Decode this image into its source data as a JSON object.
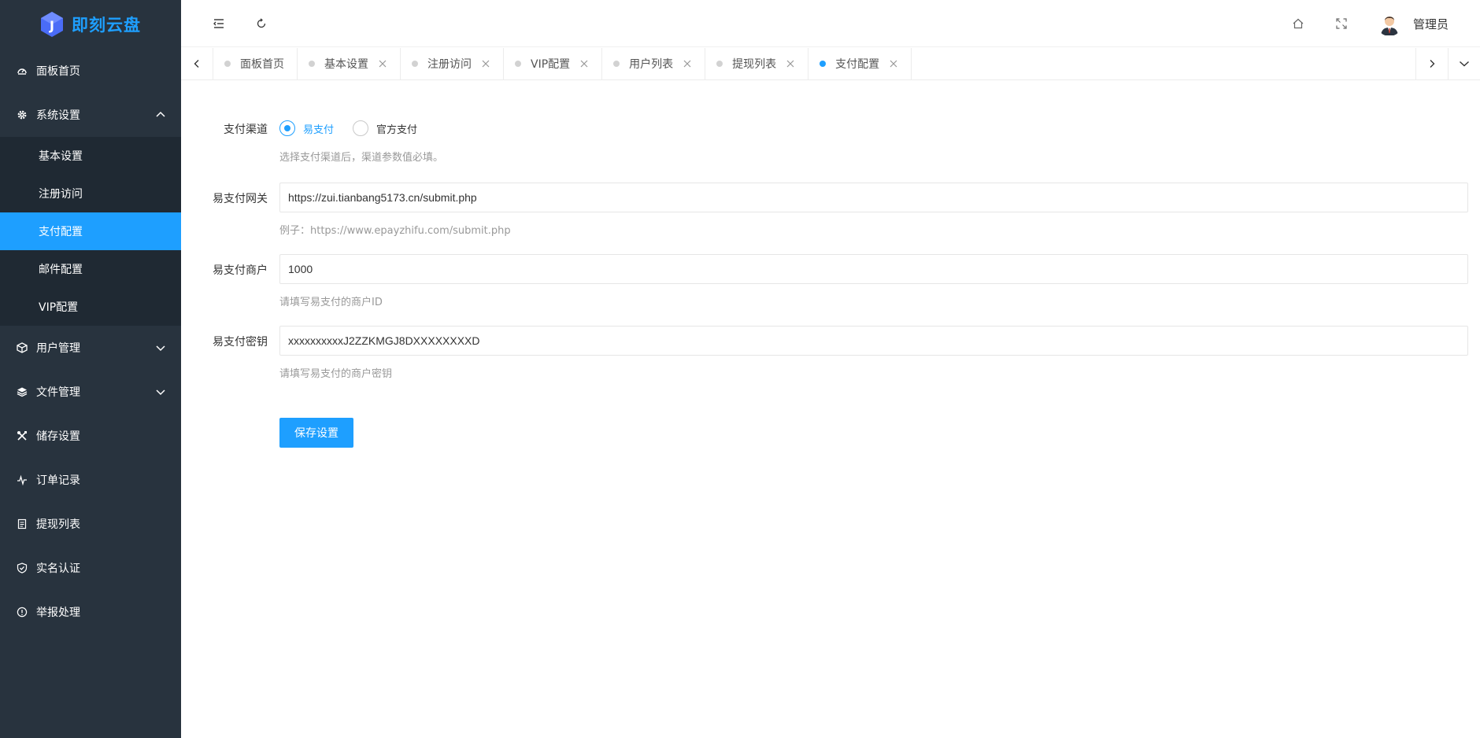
{
  "app": {
    "logo_text": "即刻云盘",
    "accent": "#1e9fff",
    "sidebar_bg": "#28333e",
    "submenu_bg": "#1f2933"
  },
  "sidebar": {
    "items": [
      {
        "label": "面板首页",
        "icon": "dashboard-icon"
      },
      {
        "label": "系统设置",
        "icon": "gear-icon",
        "expanded": true,
        "children": [
          "基本设置",
          "注册访问",
          "支付配置",
          "邮件配置",
          "VIP配置"
        ],
        "active_child": "支付配置"
      },
      {
        "label": "用户管理",
        "icon": "cube-icon",
        "collapsible": true
      },
      {
        "label": "文件管理",
        "icon": "layers-icon",
        "collapsible": true
      },
      {
        "label": "储存设置",
        "icon": "tools-icon"
      },
      {
        "label": "订单记录",
        "icon": "pulse-icon"
      },
      {
        "label": "提现列表",
        "icon": "document-icon"
      },
      {
        "label": "实名认证",
        "icon": "shield-check-icon"
      },
      {
        "label": "举报处理",
        "icon": "info-icon"
      }
    ]
  },
  "header": {
    "username": "管理员"
  },
  "tabs": {
    "items": [
      {
        "label": "面板首页",
        "closable": false,
        "active": false
      },
      {
        "label": "基本设置",
        "closable": true,
        "active": false
      },
      {
        "label": "注册访问",
        "closable": true,
        "active": false
      },
      {
        "label": "VIP配置",
        "closable": true,
        "active": false
      },
      {
        "label": "用户列表",
        "closable": true,
        "active": false
      },
      {
        "label": "提现列表",
        "closable": true,
        "active": false
      },
      {
        "label": "支付配置",
        "closable": true,
        "active": true
      }
    ]
  },
  "form": {
    "channel": {
      "label": "支付渠道",
      "options": [
        "易支付",
        "官方支付"
      ],
      "selected": "易支付",
      "hint": "选择支付渠道后，渠道参数值必填。"
    },
    "gateway": {
      "label": "易支付网关",
      "value": "https://zui.tianbang5173.cn/submit.php",
      "hint": "例子：https://www.epayzhifu.com/submit.php"
    },
    "merchant": {
      "label": "易支付商户",
      "value": "1000",
      "hint": "请填写易支付的商户ID"
    },
    "secret": {
      "label": "易支付密钥",
      "value": "xxxxxxxxxxJ2ZZKMGJ8DXXXXXXXXD",
      "hint": "请填写易支付的商户密钥"
    },
    "save_label": "保存设置"
  }
}
